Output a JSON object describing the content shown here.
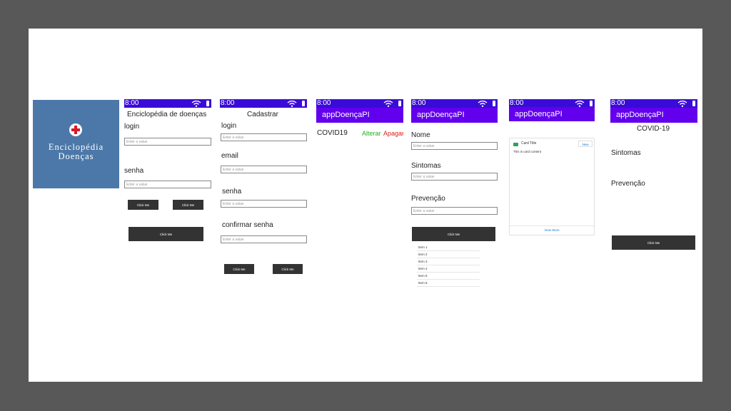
{
  "logo": {
    "title": "Enciclopédia\nDoenças"
  },
  "status_time": "8:00",
  "screen1": {
    "header": "Enciclopédia de doenças",
    "login_label": "login",
    "login_placeholder": "Enter a value",
    "senha_label": "senha",
    "senha_placeholder": "Enter a value",
    "button1": "Click Me",
    "button2": "Click Me",
    "button3": "Click Me"
  },
  "screen2": {
    "header": "Cadastrar",
    "login_label": "login",
    "login_placeholder": "Enter a value",
    "email_label": "email",
    "email_placeholder": "Enter a value",
    "senha_label": "senha",
    "senha_placeholder": "Enter a value",
    "confirm_label": "confirmar senha",
    "confirm_placeholder": "Enter a value",
    "button1": "Click Me",
    "button2": "Click Me"
  },
  "screen3": {
    "appbar": "appDoençaPI",
    "item": "COVID19",
    "alter": "Alterar",
    "delete": "Apagar",
    "colors": {
      "alter": "#1db31d",
      "delete": "#e01919"
    }
  },
  "screen4": {
    "appbar": "appDoençaPI",
    "nome_label": "Nome",
    "nome_placeholder": "Enter a value",
    "sintomas_label": "Sintomas",
    "sintomas_placeholder": "Enter a value",
    "prevencao_label": "Prevenção",
    "prevencao_placeholder": "Enter a value",
    "button": "Click Me",
    "items": [
      "Item 1",
      "Item 2",
      "Item 3",
      "Item 4",
      "Item 5",
      "Item 6"
    ]
  },
  "screen5": {
    "appbar": "appDoençaPI",
    "card_title": "Card Title",
    "card_new": "New",
    "card_content": "This is card content",
    "view_more": "View More"
  },
  "screen6": {
    "appbar": "appDoençaPI",
    "title": "COVID-19",
    "sintomas": "Sintomas",
    "prevencao": "Prevenção",
    "button": "Click Me"
  },
  "colors": {
    "statusbar": "#3a0bd8",
    "appbar": "#6200ee",
    "logo_bg": "#4b78a8"
  }
}
